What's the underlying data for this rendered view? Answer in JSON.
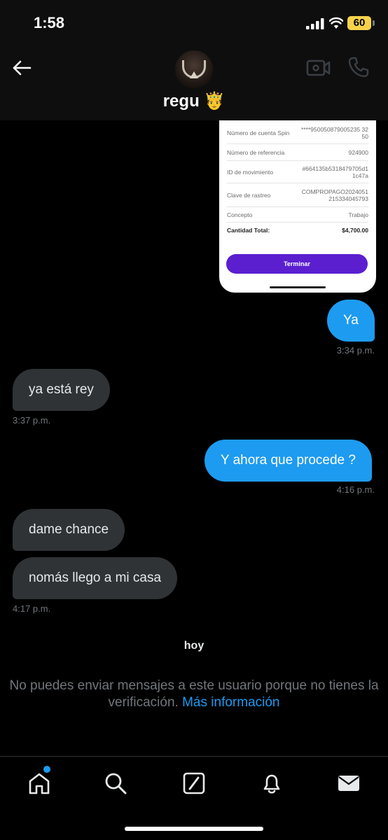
{
  "status_bar": {
    "time": "1:58",
    "battery": "60"
  },
  "header": {
    "contact_name": "regu 🤴",
    "back_icon": "arrow-left-icon",
    "video_icon": "video-camera-icon",
    "call_icon": "phone-icon"
  },
  "receipt": {
    "rows": [
      {
        "label": "Número de cuenta Spin",
        "value": "****950050879005235 3250"
      },
      {
        "label": "Número de referencia",
        "value": "924900"
      },
      {
        "label": "ID de movimiento",
        "value": "#664135b5318479705d11c47a"
      },
      {
        "label": "Clave de rastreo",
        "value": "COMPROPAGO2024051215334045793"
      },
      {
        "label": "Concepto",
        "value": "Trabajo"
      }
    ],
    "total_label": "Cantidad Total:",
    "total_value": "$4,700.00",
    "button_label": "Terminar"
  },
  "messages": [
    {
      "text": "Ya",
      "time": "3:34 p.m."
    },
    {
      "text": "ya está rey",
      "time": "3:37 p.m."
    },
    {
      "text": "Y ahora que procede ?",
      "time": "4:16 p.m."
    },
    {
      "text": "dame chance",
      "time": ""
    },
    {
      "text": "nomás llego a mi casa",
      "time": "4:17 p.m."
    }
  ],
  "day_divider": "hoy",
  "notice": {
    "text": "No puedes enviar mensajes a este usuario porque no tienes la verificación.",
    "link": "Más información"
  },
  "bottom_nav": {
    "items": [
      "home-icon",
      "search-icon",
      "compose-icon",
      "bell-icon",
      "mail-icon"
    ]
  },
  "colors": {
    "accent": "#1d9bf0",
    "incoming_bubble": "#2f3336",
    "receipt_button": "#5b1fd0"
  }
}
